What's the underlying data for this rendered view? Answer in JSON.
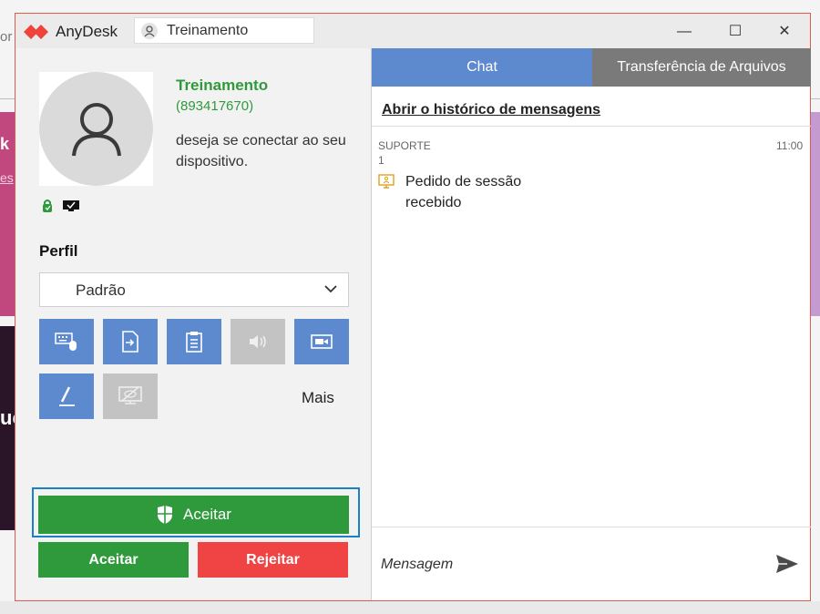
{
  "background": {
    "text_top_left": "or",
    "text_pink": "k",
    "text_pink_link": "es",
    "text_dark": "uc"
  },
  "window": {
    "app_name": "AnyDesk",
    "tab_label": "Treinamento",
    "controls": {
      "minimize": "—",
      "maximize": "☐",
      "close": "✕"
    }
  },
  "peer": {
    "name": "Treinamento",
    "id": "(893417670)",
    "message": "deseja se conectar ao seu dispositivo."
  },
  "profile": {
    "label": "Perfil",
    "selected": "Padrão"
  },
  "permissions": {
    "more_label": "Mais",
    "buttons": [
      {
        "icon": "keyboard-mouse-icon",
        "enabled": true
      },
      {
        "icon": "file-transfer-icon",
        "enabled": true
      },
      {
        "icon": "clipboard-icon",
        "enabled": true
      },
      {
        "icon": "sound-icon",
        "enabled": false
      },
      {
        "icon": "video-icon",
        "enabled": true
      },
      {
        "icon": "draw-icon",
        "enabled": true
      },
      {
        "icon": "privacy-screen-icon",
        "enabled": false
      }
    ]
  },
  "actions": {
    "accept_elevated": "Aceitar",
    "accept": "Aceitar",
    "reject": "Rejeitar"
  },
  "chat": {
    "tab_chat": "Chat",
    "tab_files": "Transferência de Arquivos",
    "history_link": "Abrir o histórico de mensagens",
    "message": {
      "sender": "SUPORTE",
      "count": "1",
      "time": "11:00",
      "text": "Pedido de sessão recebido"
    },
    "input_placeholder": "Mensagem"
  },
  "colors": {
    "accent_blue": "#5d89cf",
    "accept_green": "#2f9a3b",
    "reject_red": "#f04343",
    "brand_red": "#ef443b",
    "focus_blue": "#1a82c4"
  }
}
